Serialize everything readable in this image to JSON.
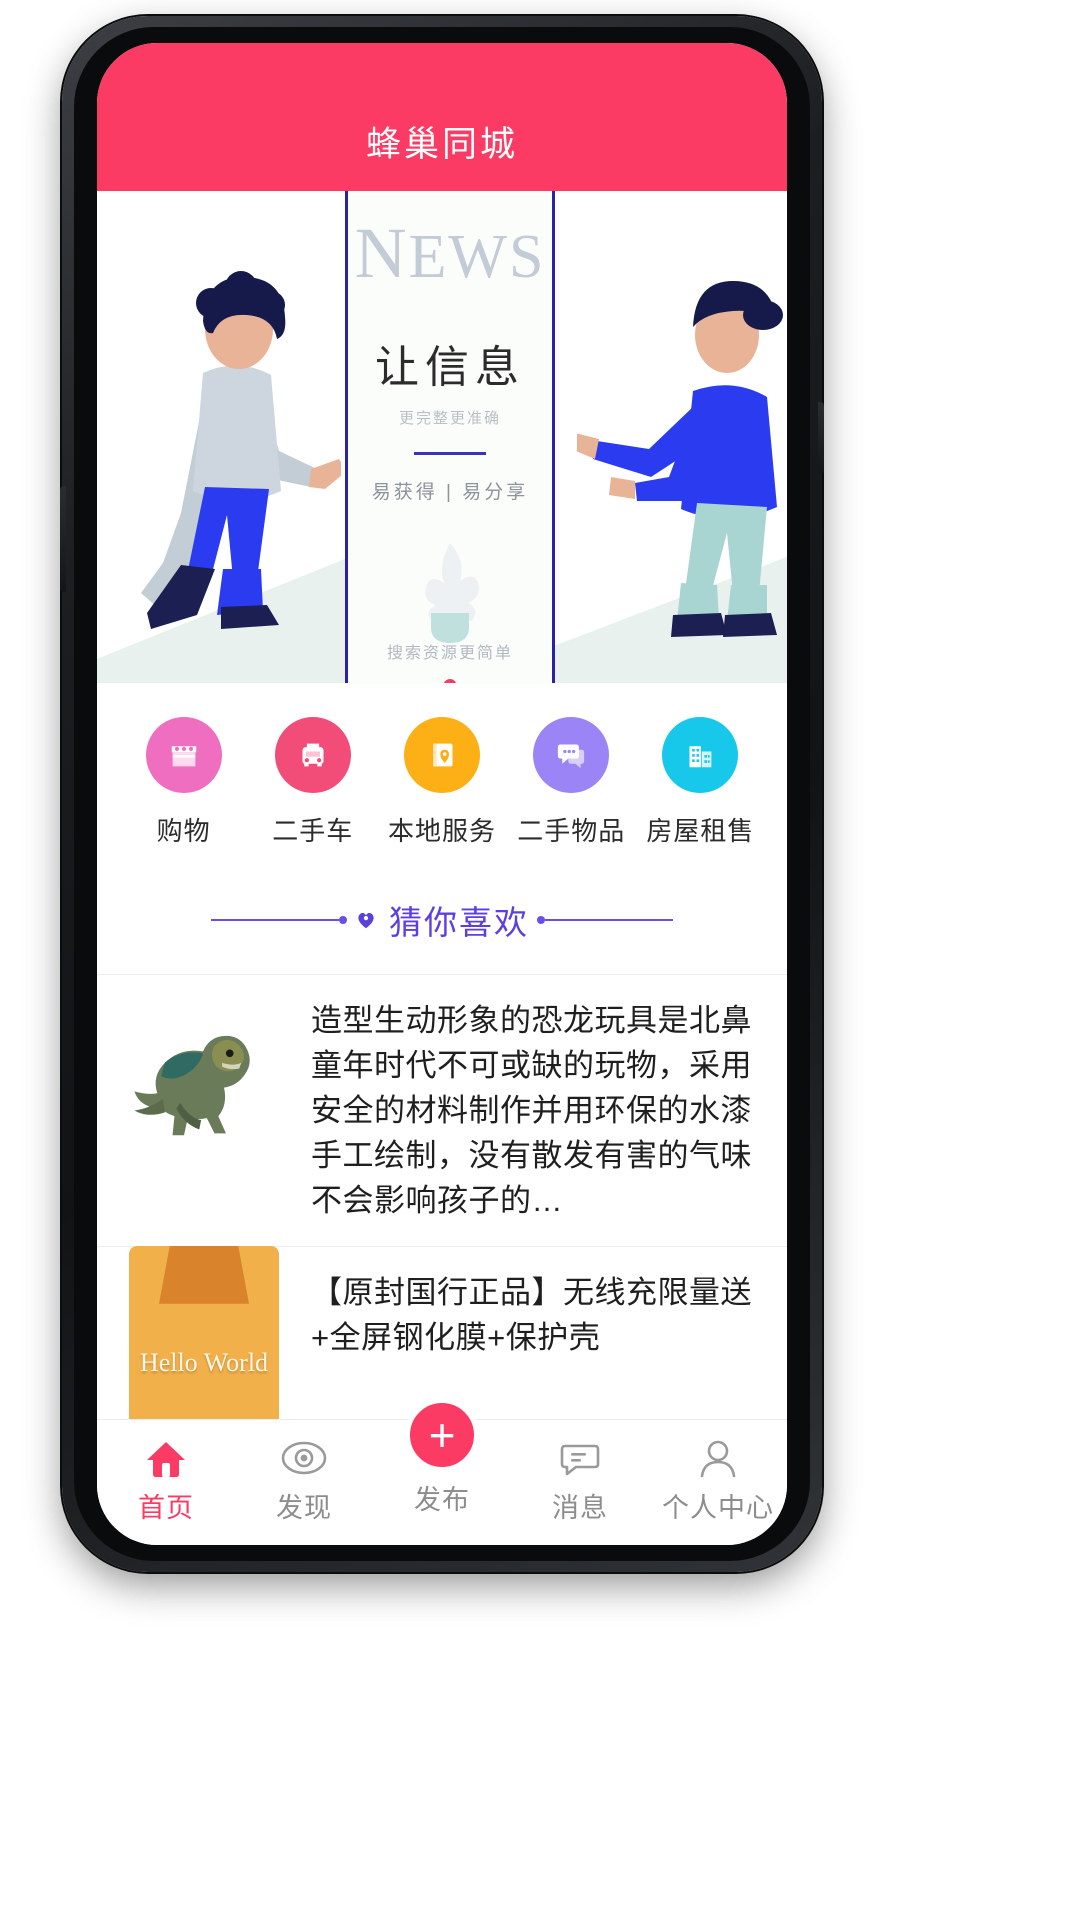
{
  "header": {
    "title": "蜂巢同城",
    "bg": "#fb3b63"
  },
  "banner": {
    "news_cap": "N",
    "news_rest": "EWS",
    "headline": "让信息",
    "subtitle": "更完整更准确",
    "tagline": "易获得 | 易分享",
    "footer": "搜索资源更简单",
    "accent": "#2b22a8",
    "dot_color": "#fb3b63",
    "dot_count": 1,
    "active_dot": 0
  },
  "categories": [
    {
      "label": "购物",
      "icon": "shop-icon",
      "color": "#f06ec0"
    },
    {
      "label": "二手车",
      "icon": "car-icon",
      "color": "#f14d78"
    },
    {
      "label": "本地服务",
      "icon": "book-pin-icon",
      "color": "#fcb016"
    },
    {
      "label": "二手物品",
      "icon": "chat-icon",
      "color": "#9b84f5"
    },
    {
      "label": "房屋租售",
      "icon": "building-icon",
      "color": "#17c8ea"
    }
  ],
  "section": {
    "title": "猜你喜欢",
    "icon": "heart-icon",
    "color": "#5b3fe0"
  },
  "feed": [
    {
      "thumb": "dinosaur-toy-image",
      "text": "造型生动形象的恐龙玩具是北鼻童年时代不可或缺的玩物，采用安全的材料制作并用环保的水漆手工绘制，没有散发有害的气味不会影响孩子的…"
    },
    {
      "thumb": "hello-world-placeholder",
      "thumb_text": "Hello World",
      "text": "【原封国行正品】无线充限量送+全屏钢化膜+保护壳"
    }
  ],
  "tabbar": {
    "active_color": "#fb3b63",
    "inactive_color": "#8d8d8d",
    "items": [
      {
        "label": "首页",
        "icon": "home-icon",
        "active": true
      },
      {
        "label": "发现",
        "icon": "compass-icon",
        "active": false
      },
      {
        "label": "发布",
        "icon": "plus-icon",
        "active": false
      },
      {
        "label": "消息",
        "icon": "message-icon",
        "active": false
      },
      {
        "label": "个人中心",
        "icon": "person-icon",
        "active": false
      }
    ]
  }
}
